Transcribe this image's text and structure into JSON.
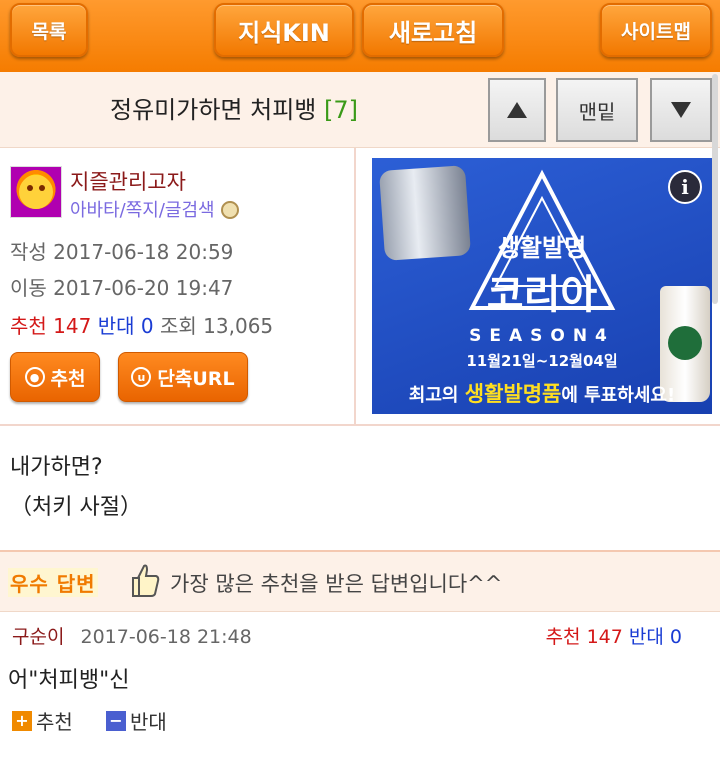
{
  "topbar": {
    "list_label": "목록",
    "kin_label": "지식KIN",
    "refresh_label": "새로고침",
    "sitemap_label": "사이트맵"
  },
  "post": {
    "title": "정유미가하면 처피뱅",
    "comment_count": "[7]",
    "bottom_label": "맨밑"
  },
  "author": {
    "name": "지즐관리고자",
    "links": "아바타/쪽지/글검색",
    "written_label": "작성",
    "written": "2017-06-18 20:59",
    "moved_label": "이동",
    "moved": "2017-06-20 19:47",
    "recommend_label": "추천",
    "recommend_count": "147",
    "oppose_label": "반대",
    "oppose_count": "0",
    "views_label": "조회",
    "views": "13,065"
  },
  "actions": {
    "recommend_label": "추천",
    "short_url_label": "단축URL"
  },
  "ad": {
    "line1": "생활발명",
    "line2": "코리아",
    "season": "SEASON4",
    "dates": "11월21일~12월04일",
    "cta_prefix": "최고의 ",
    "cta_highlight": "생활발명품",
    "cta_suffix": "에 투표하세요!"
  },
  "body": {
    "line1": "내가하면?",
    "line2": "（처키 사절）"
  },
  "best_answer": {
    "label": "우수 답변",
    "description": "가장 많은 추천을 받은 답변입니다^^",
    "user": "구순이",
    "date": "2017-06-18 21:48",
    "recommend_label": "추천",
    "recommend_count": "147",
    "oppose_label": "반대",
    "oppose_count": "0",
    "text": "어\"처피뱅\"신",
    "vote_up_label": "추천",
    "vote_down_label": "반대"
  },
  "colors": {
    "orange": "#f57c00",
    "recommend_red": "#d41818",
    "oppose_blue": "#1a3cd4",
    "comment_green": "#3a9a18"
  }
}
